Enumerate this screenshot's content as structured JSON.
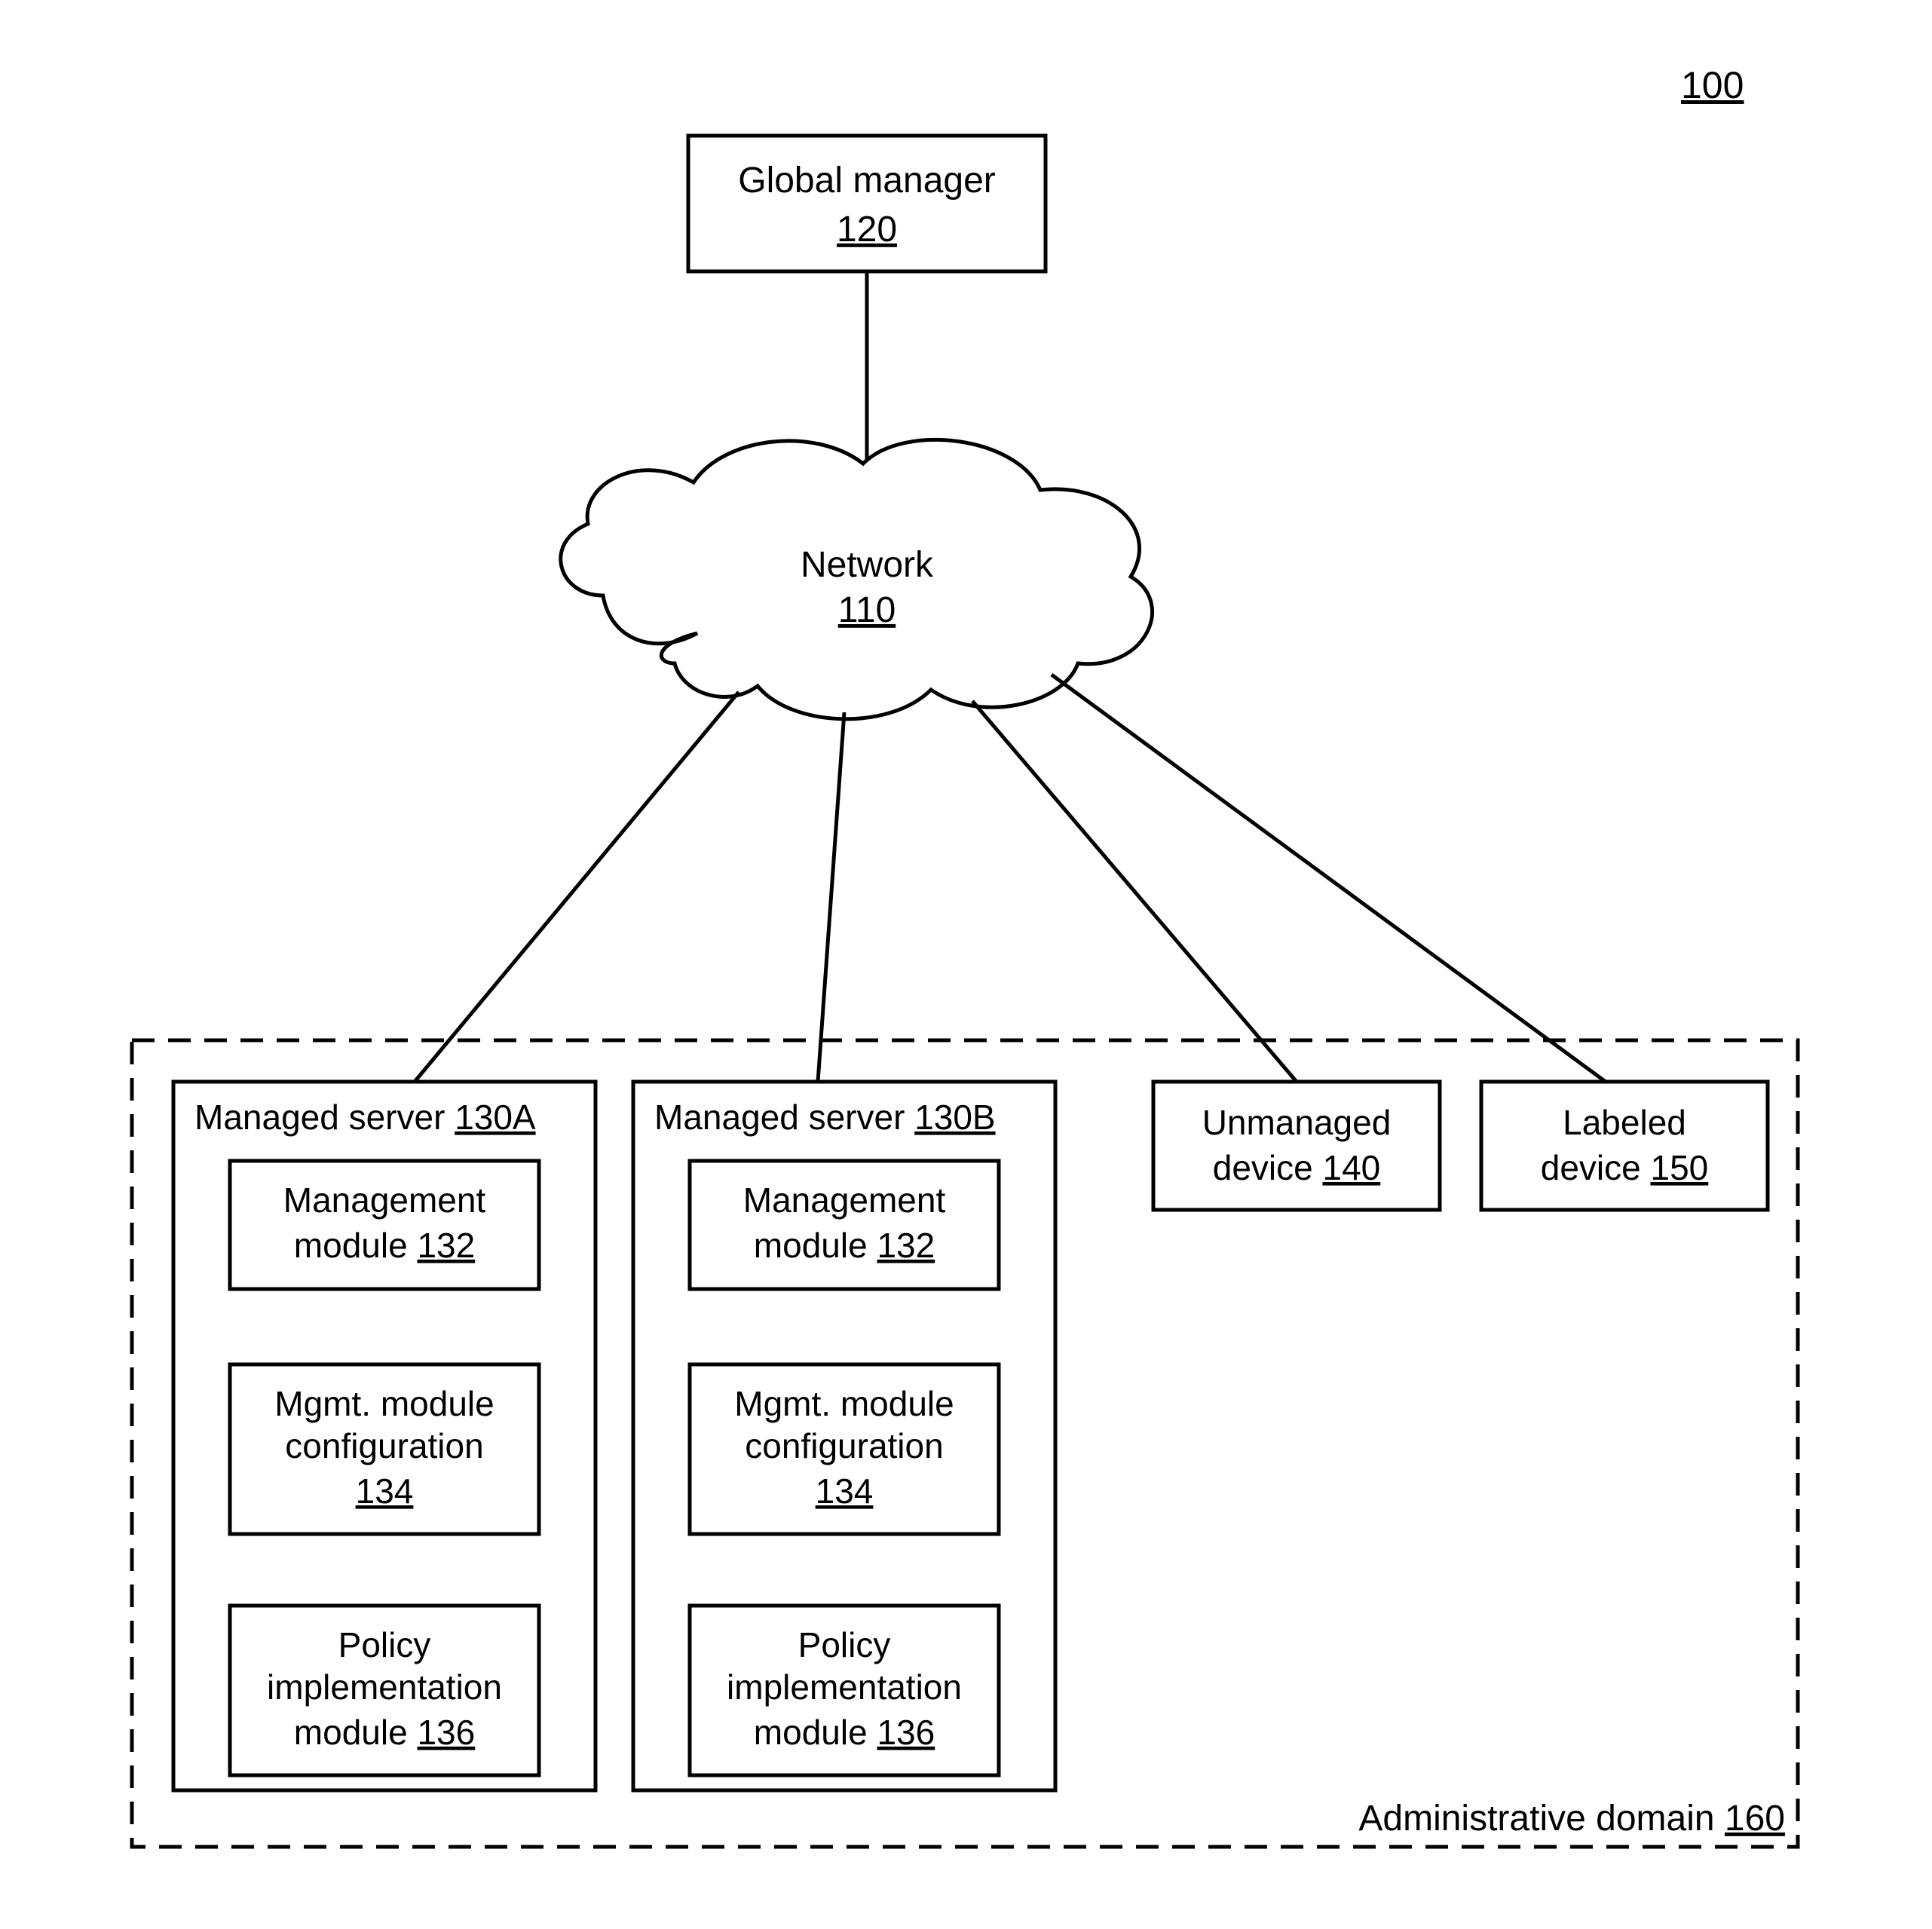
{
  "figure_ref": "100",
  "global_manager": {
    "title": "Global manager",
    "ref": "120"
  },
  "network": {
    "title": "Network",
    "ref": "110"
  },
  "admin_domain": {
    "title": "Administrative domain ",
    "ref": "160"
  },
  "managed_server_a": {
    "title": "Managed server ",
    "ref": "130A"
  },
  "managed_server_b": {
    "title": "Managed server ",
    "ref": "130B"
  },
  "module_mgmt": {
    "line1": "Management",
    "line2": "module ",
    "ref": "132"
  },
  "module_conf": {
    "line1": "Mgmt. module",
    "line2": "configuration",
    "ref": "134"
  },
  "module_policy": {
    "line1": "Policy",
    "line2": "implementation",
    "line3": "module ",
    "ref": "136"
  },
  "unmanaged": {
    "line1": "Unmanaged",
    "line2": "device ",
    "ref": "140"
  },
  "labeled": {
    "line1": "Labeled",
    "line2": "device ",
    "ref": "150"
  }
}
